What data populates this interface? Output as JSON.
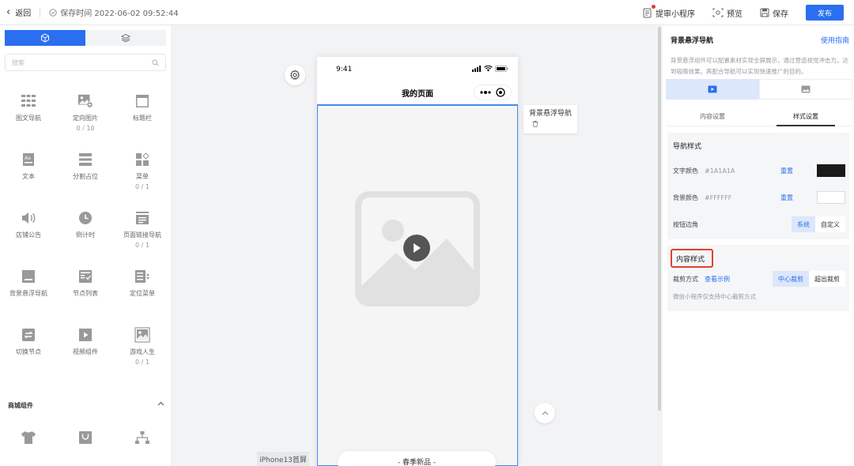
{
  "topbar": {
    "back_label": "返回",
    "save_time": "保存时间 2022-06-02 09:52:44",
    "actions": {
      "submit": "提审小程序",
      "preview": "预览",
      "save": "保存"
    },
    "publish": "发布"
  },
  "left": {
    "search_placeholder": "搜索",
    "components": [
      {
        "label": "图文导航",
        "sub": "",
        "icon": "grid-nav-icon"
      },
      {
        "label": "定向图片",
        "sub": "0 / 10",
        "icon": "image-add-icon"
      },
      {
        "label": "标题栏",
        "sub": "",
        "icon": "title-bar-icon"
      },
      {
        "label": "文本",
        "sub": "",
        "icon": "text-icon"
      },
      {
        "label": "分割占位",
        "sub": "",
        "icon": "divider-icon"
      },
      {
        "label": "菜单",
        "sub": "0 / 1",
        "icon": "menu-icon"
      },
      {
        "label": "店铺公告",
        "sub": "",
        "icon": "speaker-icon"
      },
      {
        "label": "倒计时",
        "sub": "",
        "icon": "clock-icon"
      },
      {
        "label": "页面链接导航",
        "sub": "0 / 1",
        "icon": "page-link-icon"
      },
      {
        "label": "背景悬浮导航",
        "sub": "",
        "icon": "float-nav-icon"
      },
      {
        "label": "节点列表",
        "sub": "",
        "icon": "node-list-icon"
      },
      {
        "label": "定位菜单",
        "sub": "",
        "icon": "locate-menu-icon"
      },
      {
        "label": "切换节点",
        "sub": "",
        "icon": "switch-node-icon"
      },
      {
        "label": "视频组件",
        "sub": "",
        "icon": "video-icon"
      },
      {
        "label": "游戏人生",
        "sub": "0 / 1",
        "icon": "game-image-icon"
      }
    ],
    "mall_section": "商城组件"
  },
  "canvas": {
    "phone_time": "9:41",
    "page_title": "我的页面",
    "float_tag": "背景悬浮导航",
    "pill_text": "- 春季新品 -",
    "page_tab": "iPhone13首屏"
  },
  "right": {
    "title": "背景悬浮导航",
    "guide": "使用指南",
    "desc": "背景悬浮组件可以配置素材实现全屏展示，通过营造视觉冲击力，达到吸睛效果。再配合导航可以实现快速推广的目的。",
    "tabs": [
      "内容设置",
      "样式设置"
    ],
    "nav_style": {
      "title": "导航样式",
      "text_color_label": "文字颜色",
      "text_color": "#1A1A1A",
      "bg_color_label": "背景颜色",
      "bg_color": "#FFFFFF",
      "reset": "重置",
      "corner_label": "按钮边角",
      "corner_options": [
        "系统",
        "自定义"
      ]
    },
    "content_style": {
      "title": "内容样式",
      "crop_label": "裁剪方式",
      "view_example": "查看示例",
      "crop_options": [
        "中心裁剪",
        "超出裁剪"
      ],
      "note": "微信小程序仅支持中心裁剪方式"
    }
  },
  "colors": {
    "accent": "#2a6ff0",
    "highlight": "#e0412d",
    "text_swatch": "#1A1A1A",
    "bg_swatch": "#FFFFFF"
  }
}
